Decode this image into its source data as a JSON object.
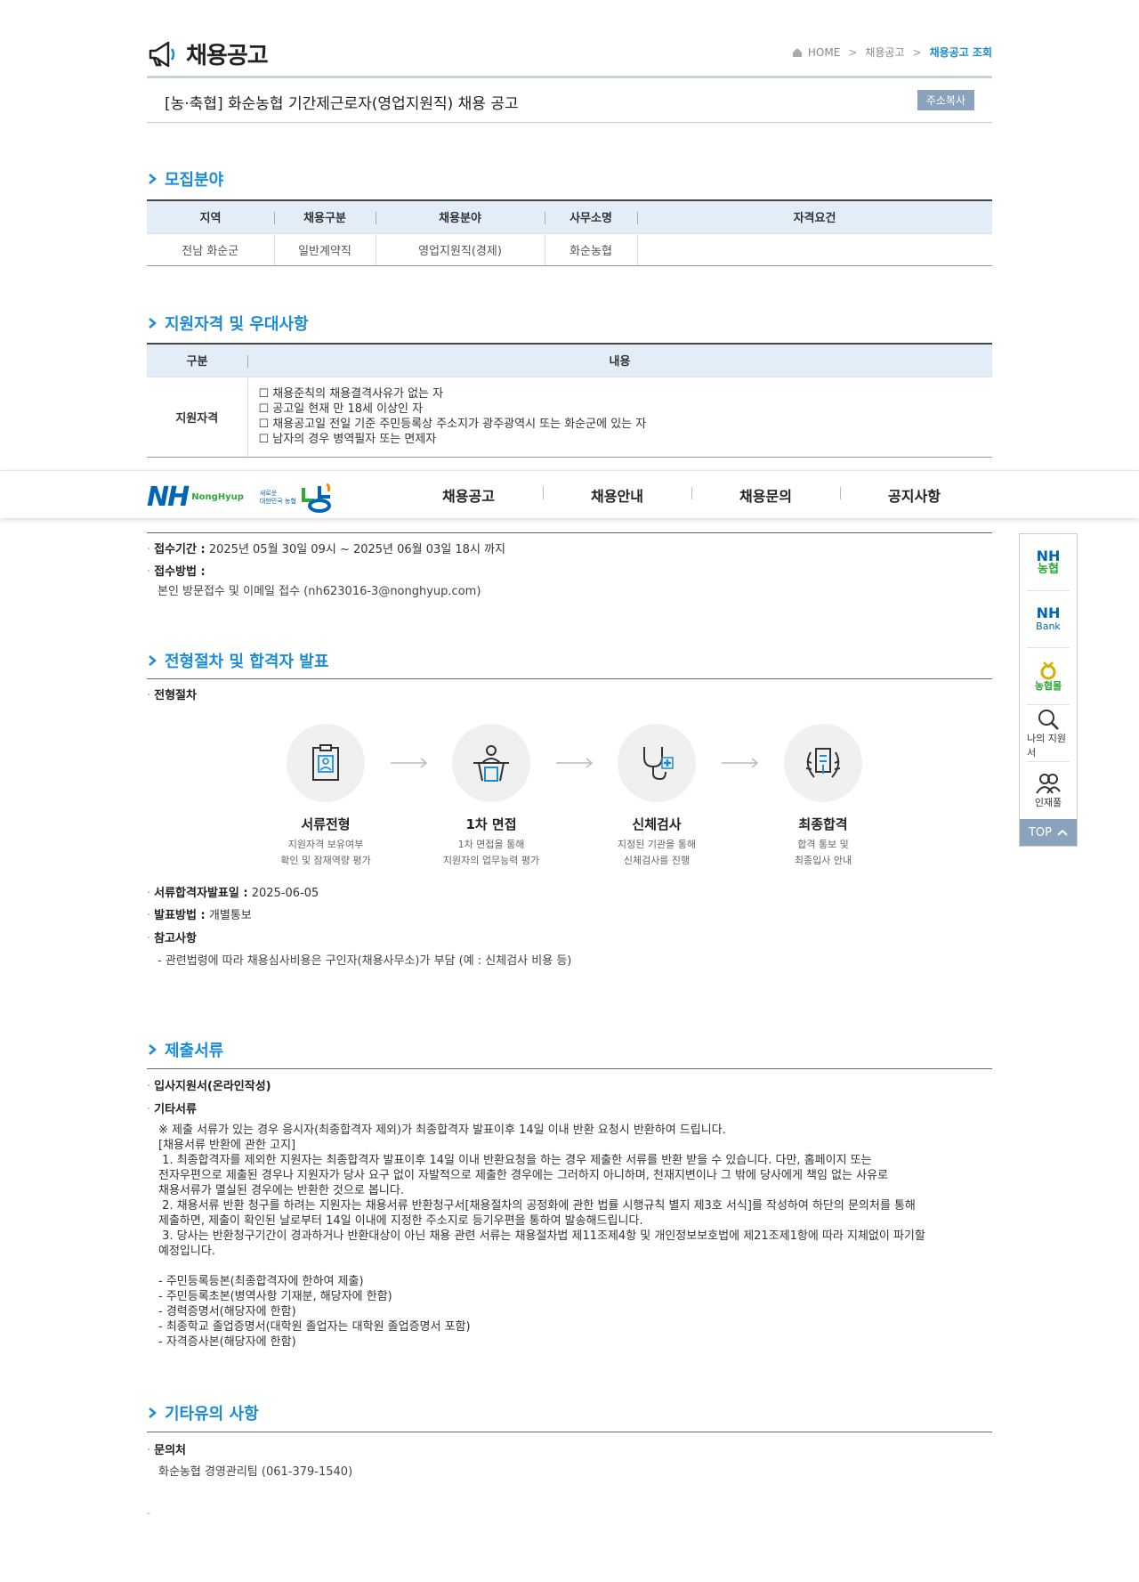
{
  "header": {
    "title": "채용공고",
    "breadcrumb": [
      "HOME",
      "채용공고",
      "채용공고 조회"
    ]
  },
  "notice": {
    "title": "[농·축협] 화순농협 기간제근로자(영업지원직) 채용 공고",
    "copy_label": "주소복사"
  },
  "recruit": {
    "section_title": "모집분야",
    "headers": [
      "지역",
      "채용구분",
      "채용분야",
      "사무소명",
      "자격요건"
    ],
    "row": [
      "전남 화순군",
      "일반계약직",
      "영업지원직(경제)",
      "화순농협",
      ""
    ]
  },
  "qualification": {
    "section_title": "지원자격 및 우대사항",
    "headers": [
      "구분",
      "내용"
    ],
    "row_label": "지원자격",
    "items": [
      "채용준칙의 채용결격사유가 없는 자",
      "공고일 현재 만 18세 이상인 자",
      "채용공고일 전일 기준 주민등록상 주소지가 광주광역시 또는 화순군에 있는 자",
      "남자의 경우 병역필자 또는 면제자"
    ]
  },
  "gnb": {
    "logo": "NH",
    "logo_sub": "NongHyup",
    "slogan_1": "새로운",
    "slogan_2": "대한민국 농협",
    "menu": [
      "채용공고",
      "채용안내",
      "채용문의",
      "공지사항"
    ]
  },
  "apply": {
    "period_label": "접수기간 :",
    "period_value": "2025년 05월 30일 09시 ~ 2025년 06월 03일 18시 까지",
    "method_label": "접수방법 :",
    "method_value": "본인 방문접수 및 이메일 접수 (nh623016-3@nonghyup.com)"
  },
  "process": {
    "section_title": "전형절차 및 합격자 발표",
    "sub_label": "전형절차",
    "steps": [
      {
        "title": "서류전형",
        "desc1": "지원자격 보유여부",
        "desc2": "확인 및 잠재역량 평가"
      },
      {
        "title": "1차 면접",
        "desc1": "1차 면접을 통해",
        "desc2": "지원자의 업무능력 평가"
      },
      {
        "title": "신체검사",
        "desc1": "지정된 기관을 통해",
        "desc2": "신체검사를 진행"
      },
      {
        "title": "최종합격",
        "desc1": "합격 통보 및",
        "desc2": "최종입사 안내"
      }
    ],
    "announce_label": "서류합격자발표일 :",
    "announce_value": "2025-06-05",
    "method_label": "발표방법 :",
    "method_value": "개별통보",
    "ref_label": "참고사항",
    "ref_value": "- 관련법령에 따라 채용심사비용은 구인자(채용사무소)가 부담 (예 : 신체검사 비용 등)"
  },
  "documents": {
    "section_title": "제출서류",
    "item1": "입사지원서(온라인작성)",
    "item2": "기타서류",
    "body": "※ 제출 서류가 있는 경우 응시자(최종합격자 제외)가 최종합격자 발표이후 14일 이내 반환 요청시 반환하여 드립니다.\n[채용서류 반환에 관한 고지]\n 1. 최종합격자를 제외한 지원자는 최종합격자 발표이후 14일 이내 반환요청을 하는 경우 제출한 서류를 반환 받을 수 있습니다. 다만, 홈페이지 또는\n전자우편으로 제출된 경우나 지원자가 당사 요구 없이 자발적으로 제출한 경우에는 그러하지 아니하며, 천재지변이나 그 밖에 당사에게 책임 없는 사유로\n채용서류가 멸실된 경우에는 반환한 것으로 봅니다.\n 2. 채용서류 반환 청구를 하려는 지원자는 채용서류 반환청구서[채용절차의 공정화에 관한 법률 시행규칙 별지 제3호 서식]를 작성하여 하단의 문의처를 통해\n제출하면, 제출이 확인된 날로부터 14일 이내에 지정한 주소지로 등기우편을 통하여 발송해드립니다.\n 3. 당사는 반환청구기간이 경과하거나 반환대상이 아닌 채용 관련 서류는 채용절차법 제11조제4항 및 개인정보보호법에 제21조제1항에 따라 지체없이 파기할\n예정입니다.\n\n- 주민등록등본(최종합격자에 한하여 제출)\n- 주민등록초본(병역사항 기재분, 해당자에 한함)\n- 경력증명서(해당자에 한함)\n- 최종학교 졸업증명서(대학원 졸업자는 대학원 졸업증명서 포함)\n- 자격증사본(해당자에 한함)"
  },
  "etc": {
    "section_title": "기타유의 사항",
    "contact_label": "문의처",
    "contact_value": "화순농협 경영관리팀 (061-379-1540)",
    "trailing": "-"
  },
  "quick": {
    "items": [
      {
        "l1": "NH",
        "l2": "농협"
      },
      {
        "l1": "NH",
        "l2": "Bank"
      },
      {
        "l1": "농협몰"
      },
      {
        "l1": "나의 지원서"
      },
      {
        "l1": "인재풀"
      }
    ],
    "top": "TOP"
  }
}
